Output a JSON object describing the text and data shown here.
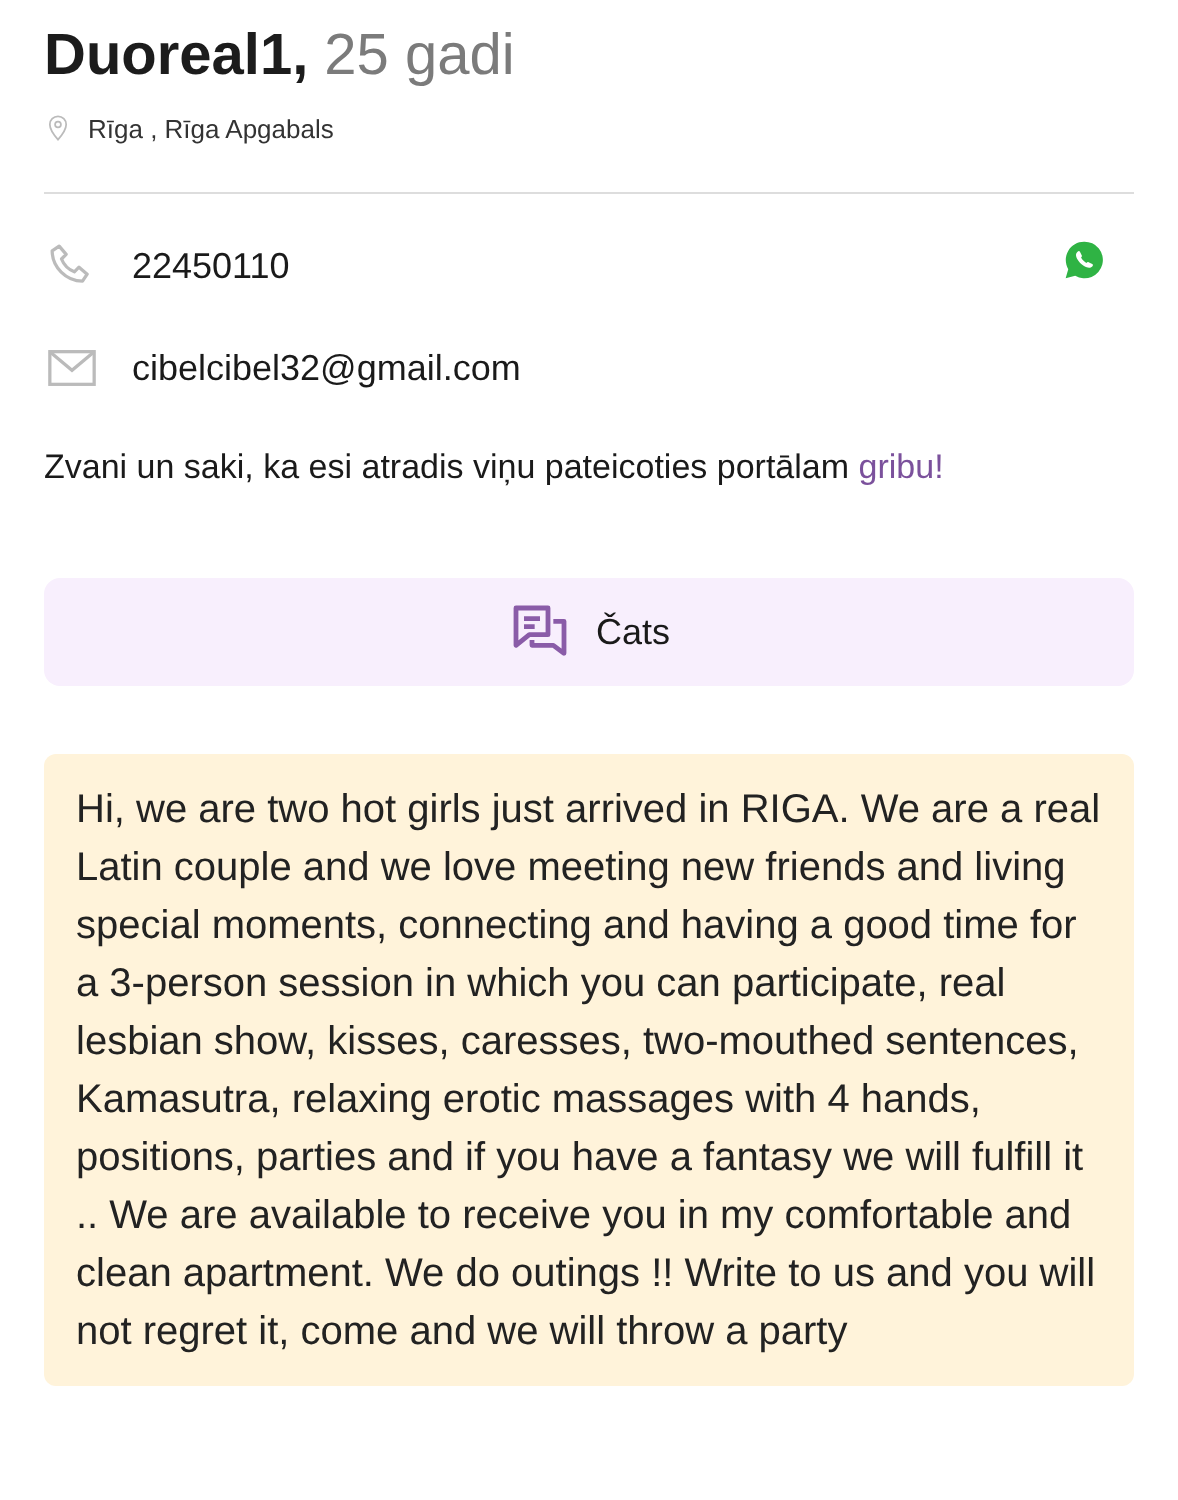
{
  "profile": {
    "name": "Duoreal1,",
    "age": "25 gadi",
    "location": "Rīga ,  Rīga Apgabals"
  },
  "contacts": [
    {
      "kind": "phone",
      "value": "22450110",
      "whatsapp": true
    },
    {
      "kind": "email",
      "value": "cibelcibel32@gmail.com",
      "whatsapp": false
    }
  ],
  "note": {
    "text": "Zvani un saki, ka esi atradis viņu pateicoties portālam ",
    "link": "gribu!"
  },
  "chat_button": {
    "label": "Čats"
  },
  "description": "Hi, we are two hot girls just arrived in RIGA. We are a real Latin couple and we love meeting new friends and living special moments, connecting and having a good time for a 3-person session in which you can participate, real lesbian show, kisses, caresses, two-mouthed sentences, Kamasutra, relaxing erotic massages with 4 hands, positions, parties and if you have a fantasy we will fulfill it .. We are available to receive you in my comfortable and clean apartment. We do outings !! Write to us and you will not regret it, come and we will throw a party"
}
